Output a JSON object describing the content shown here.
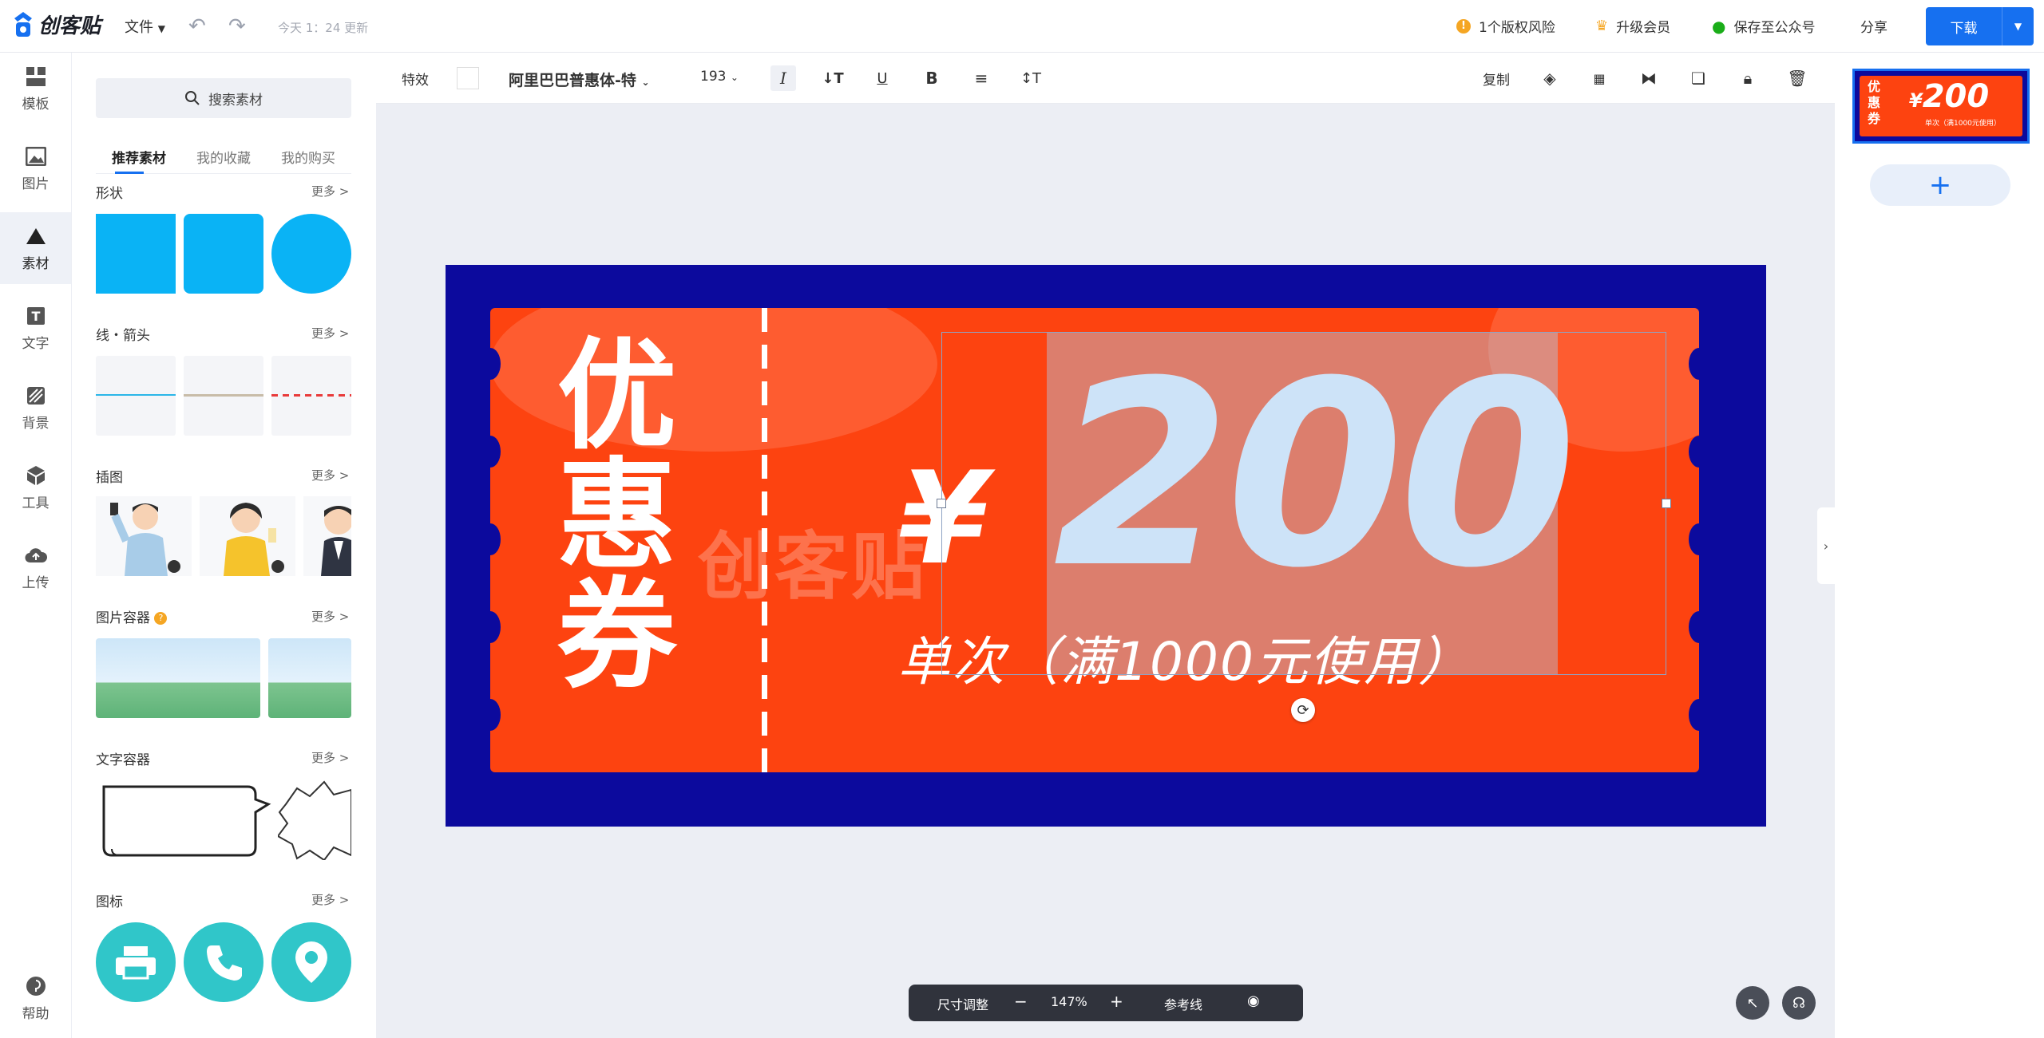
{
  "header": {
    "logo_text": "创客贴",
    "file_menu": "文件",
    "saved_text": "今天 1：24 更新",
    "copyright_risk": "1个版权风险",
    "upgrade": "升级会员",
    "save_wechat": "保存至公众号",
    "share": "分享",
    "download": "下载"
  },
  "nav": {
    "items": [
      {
        "label": "模板",
        "icon": "template-icon"
      },
      {
        "label": "图片",
        "icon": "image-icon"
      },
      {
        "label": "素材",
        "icon": "material-icon"
      },
      {
        "label": "文字",
        "icon": "text-icon"
      },
      {
        "label": "背景",
        "icon": "background-icon"
      },
      {
        "label": "工具",
        "icon": "tools-icon"
      },
      {
        "label": "上传",
        "icon": "upload-icon"
      }
    ],
    "help": "帮助"
  },
  "panel": {
    "search_placeholder": "搜索素材",
    "tabs": [
      "推荐素材",
      "我的收藏",
      "我的购买"
    ],
    "more": "更多 >",
    "sections": {
      "shapes": "形状",
      "lines": "线・箭头",
      "illustrations": "插图",
      "image_container": "图片容器",
      "text_container": "文字容器",
      "icons": "图标"
    }
  },
  "format_bar": {
    "effects": "特效",
    "font": "阿里巴巴普惠体-特",
    "font_size": "193",
    "copy": "复制"
  },
  "design": {
    "title": "优惠券",
    "yen": "¥",
    "amount": "200",
    "note": "单次（满1000元使用）",
    "watermark": "创客贴",
    "thumb_note": "单次（满1000元使用）"
  },
  "bottom_bar": {
    "resize": "尺寸调整",
    "zoom": "147%",
    "guides": "参考线"
  },
  "colors": {
    "accent": "#1670f0",
    "coupon_orange": "#fd4310",
    "coupon_navy": "#0c0a9d",
    "amount_color": "#cde3f8"
  }
}
